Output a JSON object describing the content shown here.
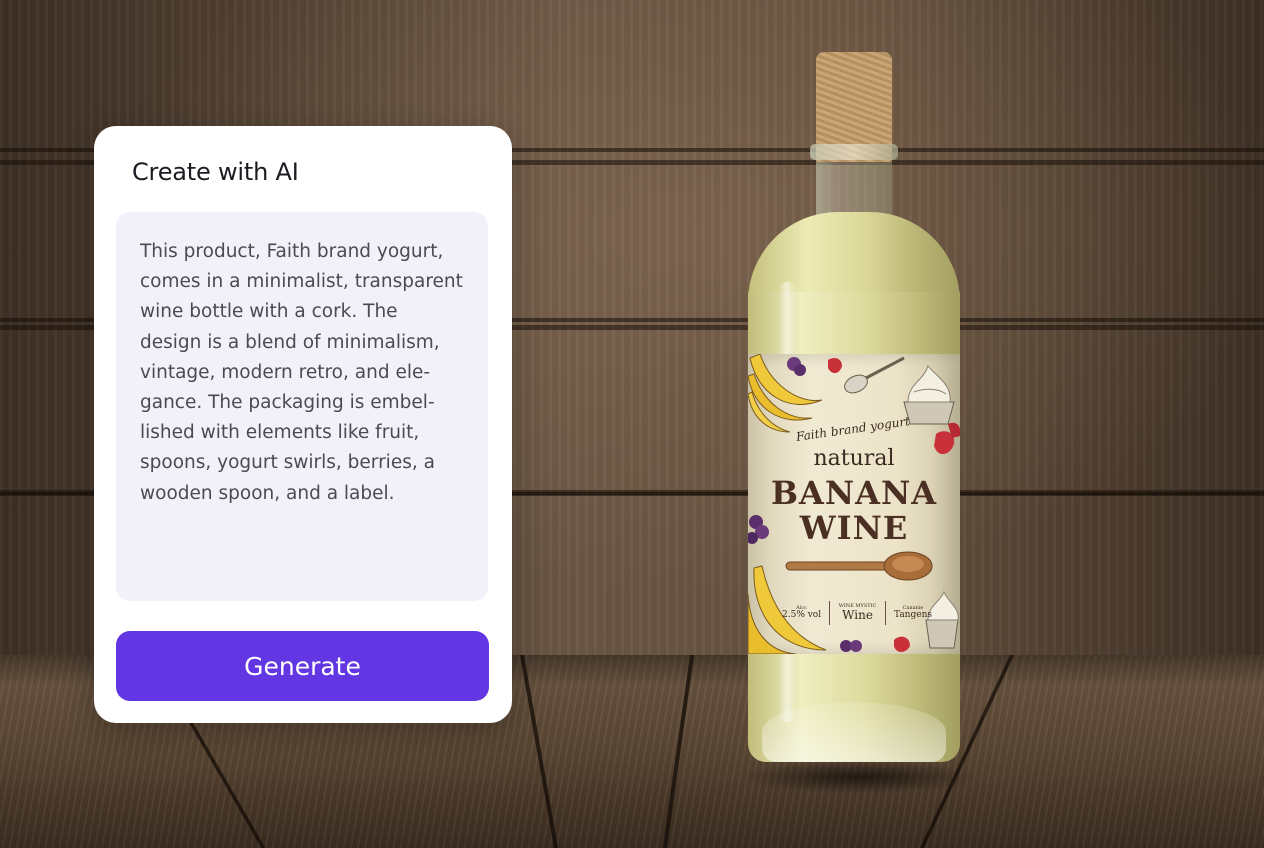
{
  "panel": {
    "title": "Create with AI",
    "prompt_text": "This product, Faith brand yogurt,\ncomes in a minimalist, transparent\nwine bottle with a cork. The\ndesign is a blend of minimalism,\nvintage, modern retro, and ele-\ngance. The packaging is embel-\nlished with elements like fruit,\nspoons, yogurt swirls, berries, a\nwooden spoon, and a label.",
    "generate_label": "Generate"
  },
  "bottle_label": {
    "brand": "Faith brand yogurt",
    "line1": "natural",
    "line2": "BANANA",
    "line3": "WINE",
    "info_left_small": "Alcc",
    "info_left_main": "2.5% vol",
    "info_mid_small": "WINE MYSTIC",
    "info_mid_main": "Wine",
    "info_right_small": "Cananie",
    "info_right_main": "Tangens"
  },
  "colors": {
    "accent": "#6237e3",
    "card_bg": "#ffffff",
    "prompt_bg": "#f2f1fa",
    "label_text": "#4a2f22"
  },
  "icons": {
    "label_illustrations": [
      "banana-icon",
      "spoon-icon",
      "yogurt-swirl-icon",
      "strawberry-icon",
      "berries-icon",
      "wooden-spoon-icon"
    ]
  }
}
